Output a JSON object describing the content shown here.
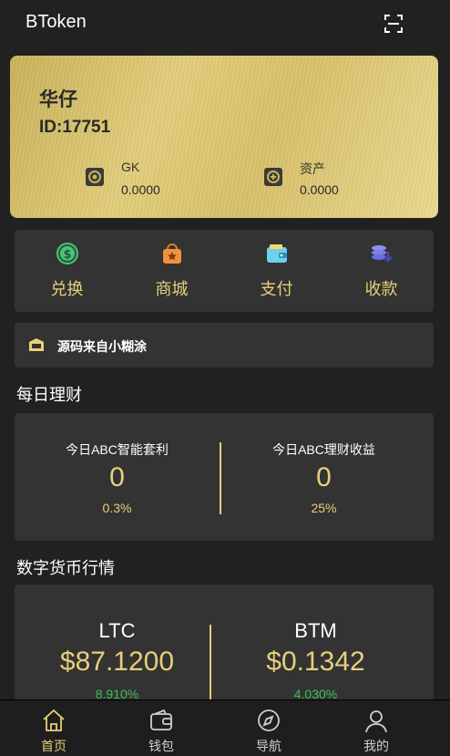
{
  "header": {
    "title": "BToken",
    "scan_icon": "scan-icon"
  },
  "card": {
    "name": "华仔",
    "id": "ID:17751",
    "assets": [
      {
        "label": "GK",
        "value": "0.0000",
        "icon": "coin-icon"
      },
      {
        "label": "资产",
        "value": "0.0000",
        "icon": "asset-icon"
      }
    ]
  },
  "actions": [
    {
      "label": "兑换",
      "icon": "exchange-icon"
    },
    {
      "label": "商城",
      "icon": "shop-icon"
    },
    {
      "label": "支付",
      "icon": "wallet-icon"
    },
    {
      "label": "收款",
      "icon": "receive-icon"
    }
  ],
  "notice": {
    "text": "源码来自小糊涂",
    "icon": "notice-icon"
  },
  "daily": {
    "title": "每日理财",
    "items": [
      {
        "label": "今日ABC智能套利",
        "value": "0",
        "rate": "0.3%"
      },
      {
        "label": "今日ABC理财收益",
        "value": "0",
        "rate": "25%"
      }
    ]
  },
  "market": {
    "title": "数字货币行情",
    "coins": [
      {
        "name": "LTC",
        "price": "$87.1200",
        "change": "8.910%"
      },
      {
        "name": "BTM",
        "price": "$0.1342",
        "change": "4.030%"
      }
    ]
  },
  "tabs": [
    {
      "label": "首页",
      "icon": "home-icon",
      "active": true
    },
    {
      "label": "钱包",
      "icon": "wallet-icon",
      "active": false
    },
    {
      "label": "导航",
      "icon": "compass-icon",
      "active": false
    },
    {
      "label": "我的",
      "icon": "user-icon",
      "active": false
    }
  ],
  "colors": {
    "accent": "#e8cf79",
    "panel": "#333333",
    "background": "#212121",
    "change_up": "#3fbf5a"
  }
}
